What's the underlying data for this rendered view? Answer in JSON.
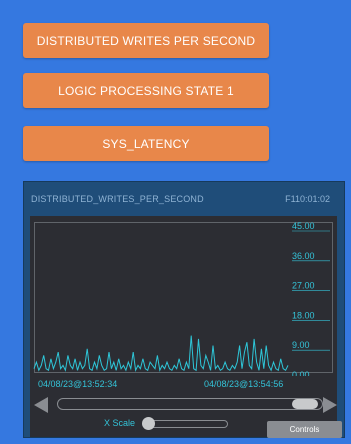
{
  "buttons": {
    "distributed_writes": "DISTRIBUTED WRITES PER SECOND",
    "logic_processing": "LOGIC PROCESSING STATE 1",
    "sys_latency": "SYS_LATENCY"
  },
  "panel": {
    "title": "DISTRIBUTED_WRITES_PER_SECOND",
    "id": "F110:01:02",
    "timestamp_start": "04/08/23@13:52:34",
    "timestamp_end": "04/08/23@13:54:56",
    "xscale_label": "X Scale",
    "controls_label": "Controls"
  },
  "colors": {
    "background": "#3578e0",
    "button": "#e8874a",
    "panel": "#1f4d79",
    "chart_bg": "#2c2d33",
    "accent": "#34c3d8"
  },
  "icons": [
    "scroll-left-arrow-icon",
    "scroll-right-arrow-icon"
  ],
  "chart_data": {
    "type": "line",
    "title": "",
    "xlabel": "",
    "ylabel": "",
    "ylim": [
      0,
      45
    ],
    "y_ticks": [
      "45.00",
      "36.00",
      "27.00",
      "18.00",
      "9.00",
      "0.00"
    ],
    "x_tick_labels": [
      "04/08/23@13:52:34",
      "04/08/23@13:54:56"
    ],
    "grid": false,
    "series": [
      {
        "values": [
          1,
          3,
          0.5,
          2,
          5,
          1,
          0.5,
          4,
          1,
          3,
          6,
          1,
          2,
          0.5,
          5,
          2,
          1,
          4,
          0.5,
          3,
          1,
          2,
          7,
          1,
          0.5,
          3,
          1,
          5,
          2,
          0.5,
          1,
          6,
          1,
          3,
          0.5,
          4,
          1,
          2,
          0.5,
          3,
          1,
          6,
          0.5,
          2,
          1,
          4,
          1,
          0.5,
          3,
          2,
          1,
          5,
          0.5,
          2,
          1,
          3,
          1,
          0.5,
          2,
          1,
          4,
          1,
          0.5,
          3,
          1,
          11,
          1,
          0.5,
          10,
          2,
          1,
          5,
          3,
          0.5,
          8,
          1,
          2,
          0.5,
          1,
          3,
          1,
          0.5,
          2,
          1,
          3,
          8,
          1,
          6,
          9,
          2,
          1,
          10,
          3,
          0.5,
          7,
          1,
          8,
          2,
          0.5,
          3,
          1,
          0.5,
          4,
          1,
          0.5,
          2
        ]
      }
    ]
  }
}
